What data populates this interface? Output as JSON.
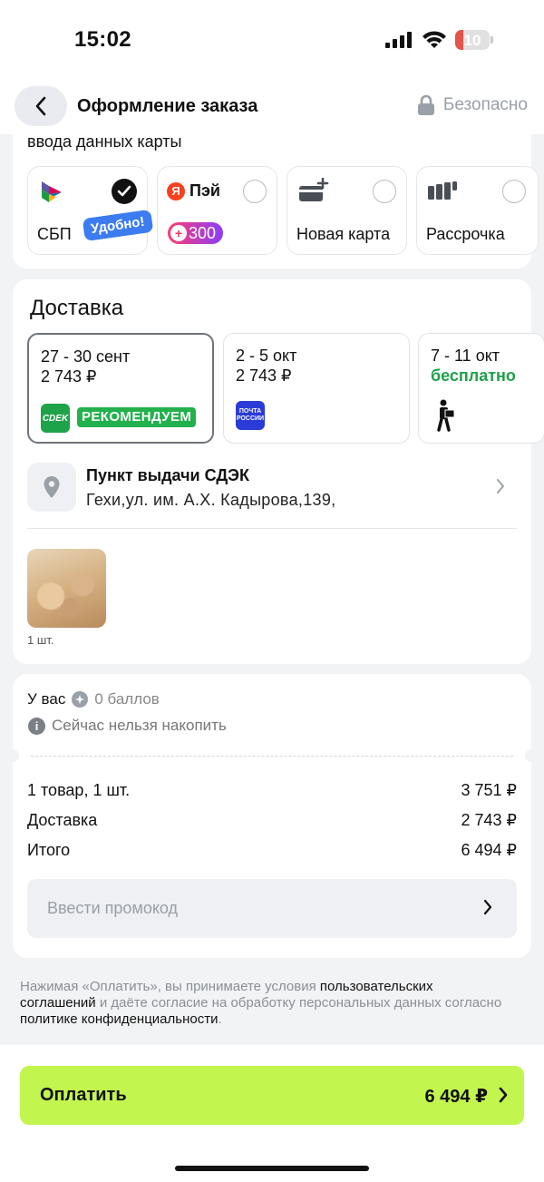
{
  "status_bar": {
    "time": "15:02",
    "battery": "10"
  },
  "nav": {
    "title": "Оформление заказа",
    "secure_label": "Безопасно"
  },
  "payment": {
    "cut_text": "ввода данных карты",
    "options": [
      {
        "label": "СБП",
        "badge": "Удобно!",
        "selected": true,
        "icon": "sbp-icon"
      },
      {
        "label": "Пэй",
        "badge": "300",
        "selected": false,
        "icon": "yandex-pay-icon"
      },
      {
        "label": "Новая карта",
        "selected": false,
        "icon": "new-card-icon"
      },
      {
        "label": "Рассрочка",
        "selected": false,
        "icon": "installment-icon"
      }
    ]
  },
  "delivery": {
    "title": "Доставка",
    "options": [
      {
        "dates": "27 - 30 сент",
        "price": "2 743 ₽",
        "badge": "РЕКОМЕНДУЕМ",
        "carrier": "CDEK",
        "selected": true
      },
      {
        "dates": "2 - 5 окт",
        "price": "2 743 ₽",
        "carrier": "ПОЧТА РОССИИ",
        "selected": false
      },
      {
        "dates": "7 - 11 окт",
        "price": "бесплатно",
        "carrier": "courier",
        "selected": false
      }
    ],
    "pickup": {
      "title": "Пункт выдачи СДЭК",
      "address": "Гехи,ул. им. А.Х. Кадырова,139,"
    },
    "product_qty": "1 шт."
  },
  "bonus": {
    "prefix": "У вас",
    "value": "0 баллов",
    "info": "Сейчас нельзя накопить"
  },
  "summary": {
    "rows": [
      {
        "label": "1 товар, 1 шт.",
        "value": "3 751 ₽"
      },
      {
        "label": "Доставка",
        "value": "2 743 ₽"
      },
      {
        "label": "Итого",
        "value": "6 494 ₽"
      }
    ],
    "promo_placeholder": "Ввести промокод"
  },
  "legal": {
    "part1": "Нажимая «Оплатить», вы принимаете условия ",
    "link1": "пользовательских соглашений",
    "part2": " и даёте согласие на обработку персональных данных согласно ",
    "link2": "политике конфиденциальности",
    "part3": "."
  },
  "pay_button": {
    "label": "Оплатить",
    "amount": "6 494 ₽"
  },
  "colors": {
    "accent": "#c3f54f",
    "recommend": "#22b14c",
    "free": "#1fa04a",
    "sbp_badge": "#3c7cf0"
  }
}
